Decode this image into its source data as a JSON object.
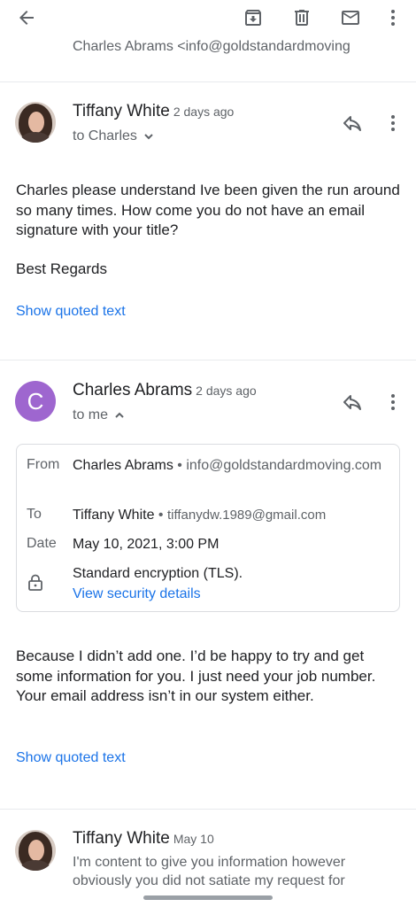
{
  "toolbar": {
    "icons": [
      "back-arrow-icon",
      "archive-icon",
      "delete-icon",
      "mark-unread-icon",
      "more-vert-icon"
    ]
  },
  "collapsed_message": {
    "text": "Charles Abrams <info@goldstandardmoving"
  },
  "messages": [
    {
      "sender": "Tiffany White",
      "date": "2 days ago",
      "recipient": "to Charles",
      "avatar": "photo",
      "body": "Charles please understand Ive been given the run around so many times. How come you do not have an email signature with your title?",
      "signoff": "Best Regards",
      "quoted_link": "Show quoted text"
    },
    {
      "sender": "Charles Abrams",
      "date": "2 days ago",
      "recipient": "to me",
      "avatar_letter": "C",
      "avatar_color": "#9e66cf",
      "details": {
        "from_label": "From",
        "from_name": "Charles Abrams",
        "from_email": "info@goldstandardmoving.com",
        "to_label": "To",
        "to_name": "Tiffany White",
        "to_email": "tiffanydw.1989@gmail.com",
        "date_label": "Date",
        "date_value": "May 10, 2021, 3:00 PM",
        "encryption": "Standard encryption (TLS).",
        "security_link": "View security details"
      },
      "body": "Because I didn’t add one. I’d be happy to try and get some information for you. I just need your job number. Your email address isn’t in our system either.",
      "quoted_link": "Show quoted text"
    },
    {
      "sender": "Tiffany White",
      "date": "May 10",
      "avatar": "photo",
      "preview": "I'm content to give you information however obviously you did not satiate my request for"
    }
  ],
  "colors": {
    "link": "#1a73e8",
    "secondary_text": "#5f6368",
    "primary_text": "#202124"
  }
}
